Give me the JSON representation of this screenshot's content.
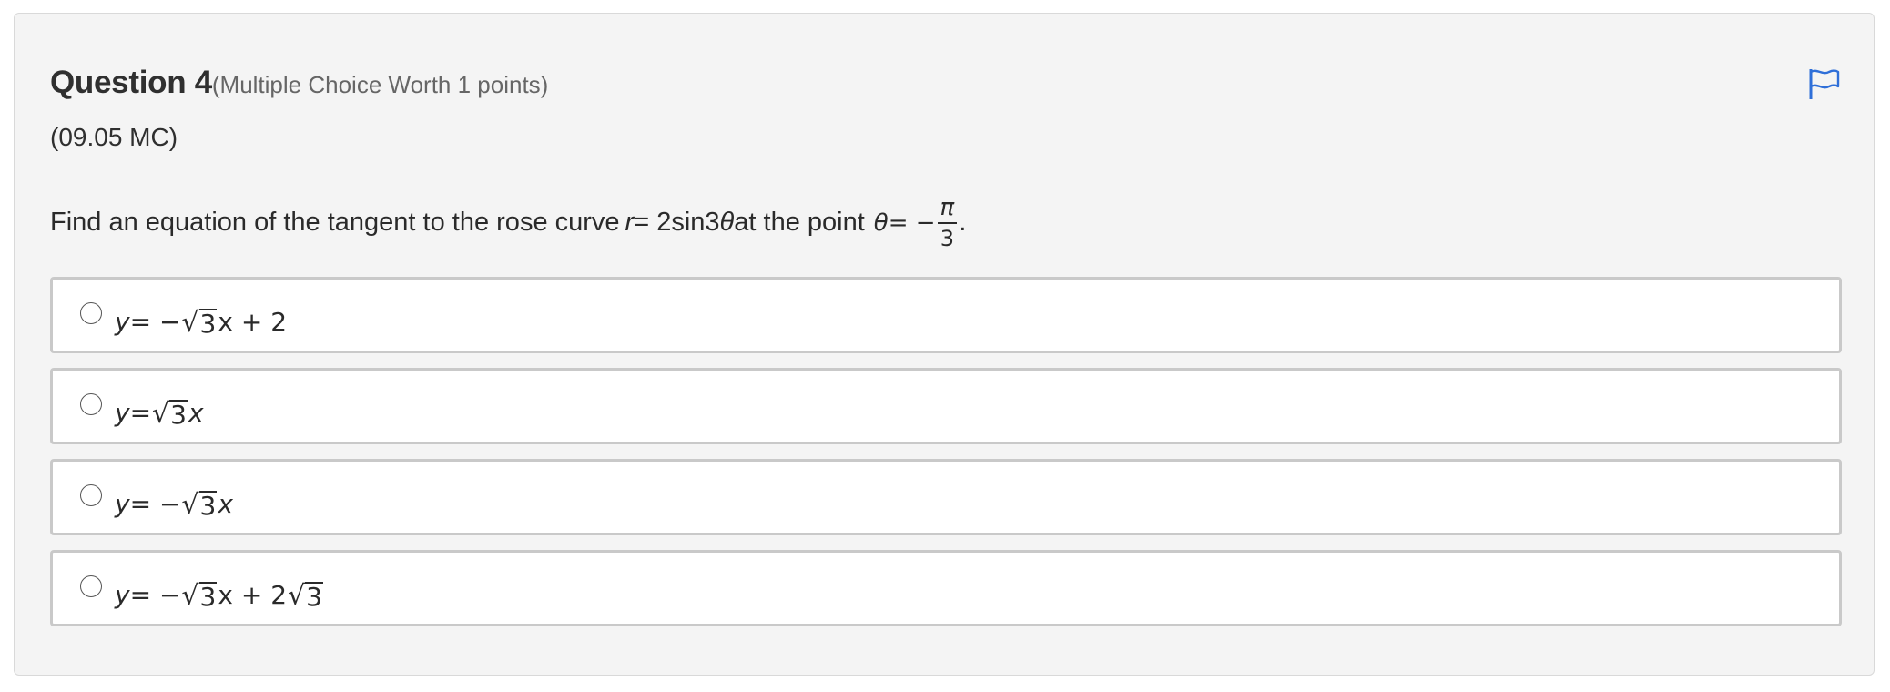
{
  "question": {
    "title": "Question 4",
    "meta": "(Multiple Choice Worth 1 points)",
    "code": "(09.05 MC)",
    "prompt_before": "Find an equation of the tangent to the rose curve",
    "prompt_r": "r",
    "prompt_eq": " = 2sin3",
    "prompt_theta": "θ",
    "prompt_mid": " at the point",
    "theta_var": "θ",
    "theta_eq": " = −",
    "frac_num": "π",
    "frac_den": "3",
    "period": "."
  },
  "options": [
    {
      "y": "y",
      "eq": " = −",
      "rad": "3",
      "tail": "x + 2",
      "tail2": ""
    },
    {
      "y": "y",
      "eq": " = ",
      "rad": "3",
      "tail": "x",
      "tail2": ""
    },
    {
      "y": "y",
      "eq": " = −",
      "rad": "3",
      "tail": "x",
      "tail2": ""
    },
    {
      "y": "y",
      "eq": " = −",
      "rad": "3",
      "tail": "x + 2",
      "tail2": "3"
    }
  ],
  "icons": {
    "flag": "flag-icon"
  },
  "colors": {
    "accent": "#2f6fd8",
    "card_bg": "#f4f4f4",
    "option_border": "#c9c9c9"
  }
}
